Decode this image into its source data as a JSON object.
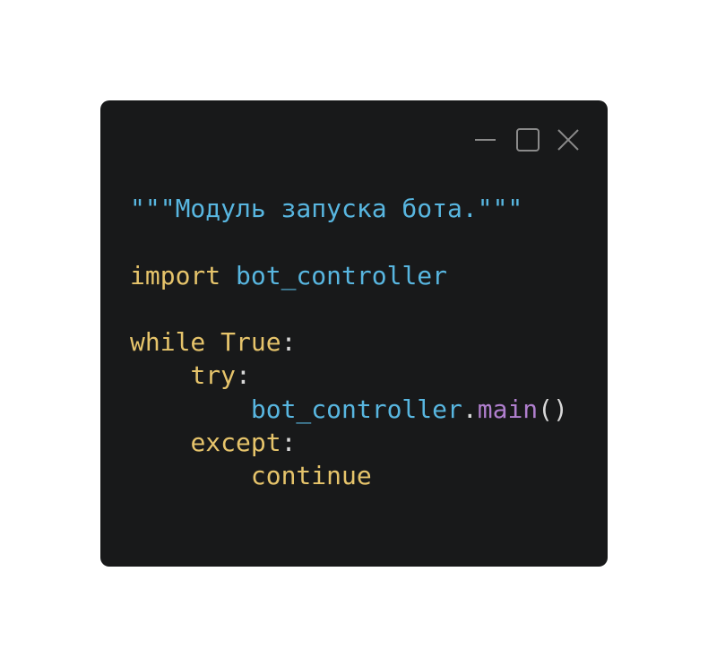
{
  "window": {
    "controls": {
      "minimize_icon": "minimize-icon",
      "maximize_icon": "maximize-icon",
      "close_icon": "close-icon"
    }
  },
  "colors": {
    "background": "#18191a",
    "docstring": "#58b6e0",
    "keyword": "#e6c46b",
    "identifier": "#58b6e0",
    "function": "#b07fce",
    "punctuation": "#d8d8d8"
  },
  "code": {
    "line1": {
      "docstring": "\"\"\"Модуль запуска бота.\"\"\""
    },
    "line3": {
      "keyword": "import",
      "module": "bot_controller"
    },
    "line5": {
      "keyword_while": "while",
      "keyword_true": "True",
      "colon": ":"
    },
    "line6": {
      "indent": "    ",
      "keyword": "try",
      "colon": ":"
    },
    "line7": {
      "indent": "        ",
      "object": "bot_controller",
      "dot": ".",
      "method": "main",
      "parens": "()"
    },
    "line8": {
      "indent": "    ",
      "keyword": "except",
      "colon": ":"
    },
    "line9": {
      "indent": "        ",
      "keyword": "continue"
    }
  }
}
